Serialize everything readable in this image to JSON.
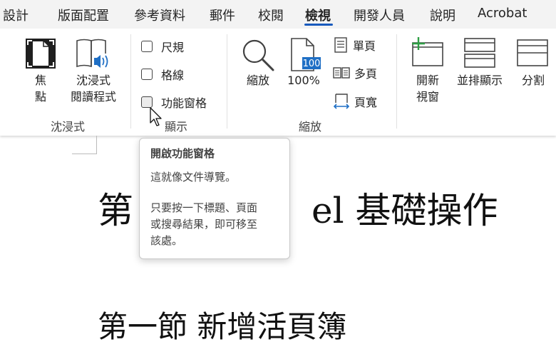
{
  "tabs": [
    {
      "label": "設計",
      "active": false
    },
    {
      "label": "版面配置",
      "active": false
    },
    {
      "label": "參考資料",
      "active": false
    },
    {
      "label": "郵件",
      "active": false
    },
    {
      "label": "校閱",
      "active": false
    },
    {
      "label": "檢視",
      "active": true
    },
    {
      "label": "開發人員",
      "active": false
    },
    {
      "label": "說明",
      "active": false
    },
    {
      "label": "Acrobat",
      "active": false
    }
  ],
  "ribbon": {
    "immersive": {
      "group_label": "沈浸式",
      "focus_line1": "焦",
      "focus_line2": "點",
      "reader_line1": "沈浸式",
      "reader_line2": "閱讀程式"
    },
    "show": {
      "group_label": "顯示",
      "ruler": {
        "label": "尺規",
        "checked": false
      },
      "gridlines": {
        "label": "格線",
        "checked": false
      },
      "navpane": {
        "label": "功能窗格",
        "checked": false
      }
    },
    "zoom": {
      "group_label": "縮放",
      "zoom_label": "縮放",
      "zoom100_label": "100%",
      "zoom100_icon_text": "100",
      "one_page": "單頁",
      "multiple_pages": "多頁",
      "page_width": "頁寬"
    },
    "window": {
      "new_window_line1": "開新",
      "new_window_line2": "視窗",
      "side_by_side": "並排顯示",
      "split": "分割"
    }
  },
  "tooltip": {
    "title": "開啟功能窗格",
    "line1": "這就像文件導覽。",
    "line2": "只要按一下標題、頁面",
    "line3": "或搜尋結果，即可移至",
    "line4": "該處。"
  },
  "document": {
    "heading1_part1": "第",
    "heading1_part2": "el 基礎操作",
    "heading2": "第一節  新增活頁簿"
  },
  "colors": {
    "accent": "#185abd",
    "icon_blue": "#1f6fc5",
    "icon_green": "#2e9e44"
  }
}
